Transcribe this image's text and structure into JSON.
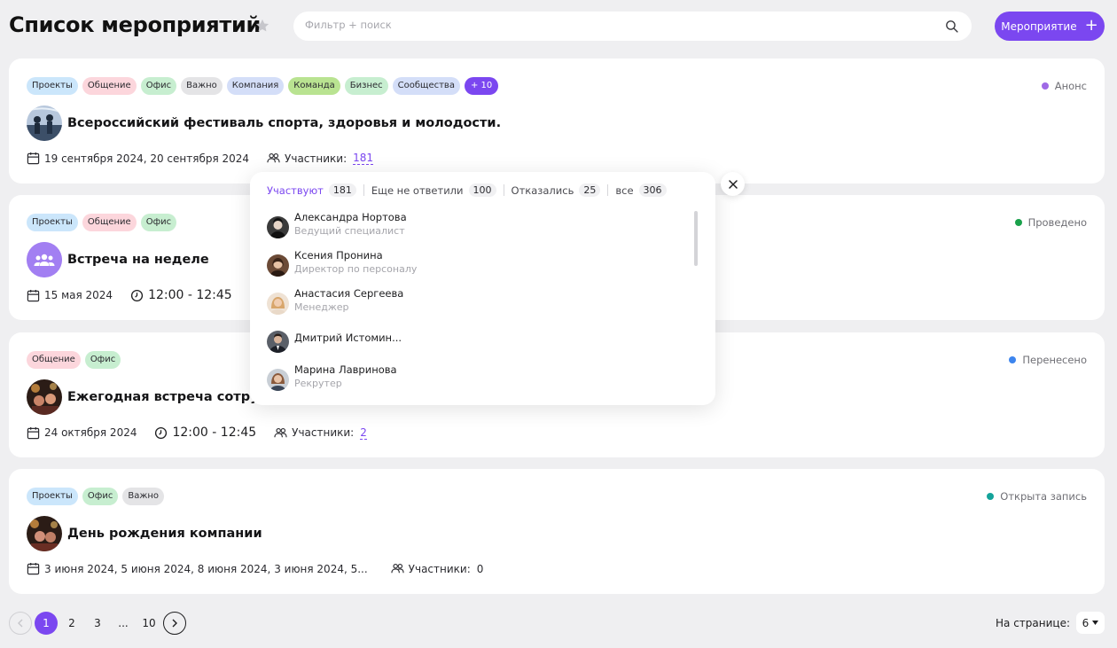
{
  "header": {
    "title": "Список мероприятий",
    "search_placeholder": "Фильтр + поиск",
    "add_button": "Мероприятие"
  },
  "colors": {
    "accent": "#7b47f0",
    "tag_blue": "#cbe6fb",
    "tag_pink": "#fcd6dc",
    "tag_green": "#c7eed0",
    "tag_gray": "#e4e4e6",
    "tag_periwinkle": "#d4def8",
    "tag_lime": "#b9e391",
    "status_purple": "#9f6ae6",
    "status_green": "#1aa14b",
    "status_blue": "#3d85ee",
    "status_teal": "#14a39a"
  },
  "events": [
    {
      "tags": [
        "Проекты",
        "Общение",
        "Офис",
        "Важно",
        "Компания",
        "Команда",
        "Бизнес",
        "Сообщества"
      ],
      "more_tags": "+ 10",
      "status": "Анонс",
      "title": "Всероссийский фестиваль спорта, здоровья и молодости.",
      "dates": "19 сентября 2024, 20 сентября 2024",
      "time": "",
      "participants_label": "Участники:",
      "participants_count": "181"
    },
    {
      "tags": [
        "Проекты",
        "Общение",
        "Офис"
      ],
      "status": "Проведено",
      "title": "Встреча на неделе",
      "dates": "15 мая 2024",
      "time": "12:00 - 12:45",
      "participants_label": "",
      "participants_count": ""
    },
    {
      "tags": [
        "Общение",
        "Офис"
      ],
      "status": "Перенесено",
      "title": "Ежегодная встреча сотрудни...",
      "dates": "24 октября 2024",
      "time": "12:00 - 12:45",
      "participants_label": "Участники:",
      "participants_count": "2"
    },
    {
      "tags": [
        "Проекты",
        "Офис",
        "Важно"
      ],
      "status": "Открыта запись",
      "title": "День рождения компании",
      "dates": "3 июня 2024, 5 июня 2024, 8 июня 2024, 3 июня 2024, 5...",
      "time": "",
      "participants_label": "Участники:",
      "participants_count": "0"
    }
  ],
  "participants_popup": {
    "tabs": [
      {
        "label": "Участвуют",
        "count": "181"
      },
      {
        "label": "Еще не ответили",
        "count": "100"
      },
      {
        "label": "Отказались",
        "count": "25"
      },
      {
        "label": "все",
        "count": "306"
      }
    ],
    "people": [
      {
        "name": "Александра Нортова",
        "role": "Ведущий специалист"
      },
      {
        "name": "Ксения Пронина",
        "role": "Директор по персоналу"
      },
      {
        "name": "Анастасия Сергеева",
        "role": "Менеджер"
      },
      {
        "name": "Дмитрий Истомин...",
        "role": ""
      },
      {
        "name": "Марина Лавринова",
        "role": "Рекрутер"
      }
    ]
  },
  "pagination": {
    "pages": [
      "1",
      "2",
      "3",
      "...",
      "10"
    ],
    "per_page_label": "На странице:",
    "per_page_value": "6"
  }
}
